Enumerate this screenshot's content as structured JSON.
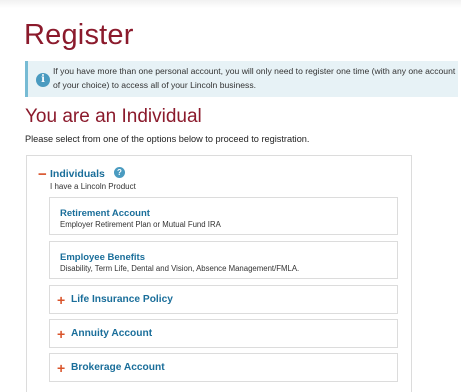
{
  "page": {
    "title": "Register",
    "info_text": "If you have more than one personal account, you will only need to register one time (with any one account of your choice) to access all of your Lincoln business.",
    "subtitle": "You are an Individual",
    "instructions": "Please select from one of the options below to proceed to registration."
  },
  "individuals": {
    "toggle": "−",
    "title": "Individuals",
    "help_icon": "?",
    "subtitle": "I have a Lincoln Product",
    "options": [
      {
        "title": "Retirement Account",
        "description": "Employer Retirement Plan or Mutual Fund IRA"
      },
      {
        "title": "Employee Benefits",
        "description": "Disability, Term Life, Dental and Vision, Absence Management/FMLA."
      }
    ]
  },
  "accordions": [
    {
      "toggle": "+",
      "label": "Life Insurance Policy"
    },
    {
      "toggle": "+",
      "label": "Annuity Account"
    },
    {
      "toggle": "+",
      "label": "Brokerage Account"
    }
  ],
  "icons": {
    "info": "i",
    "info_icon_name": "info-icon",
    "help_icon_name": "help-icon"
  },
  "colors": {
    "brand": "#8b1a2c",
    "link": "#1a6e9a",
    "toggle": "#d9542b",
    "info_bg": "#e7f2f6",
    "info_icon": "#4a9bc0"
  }
}
